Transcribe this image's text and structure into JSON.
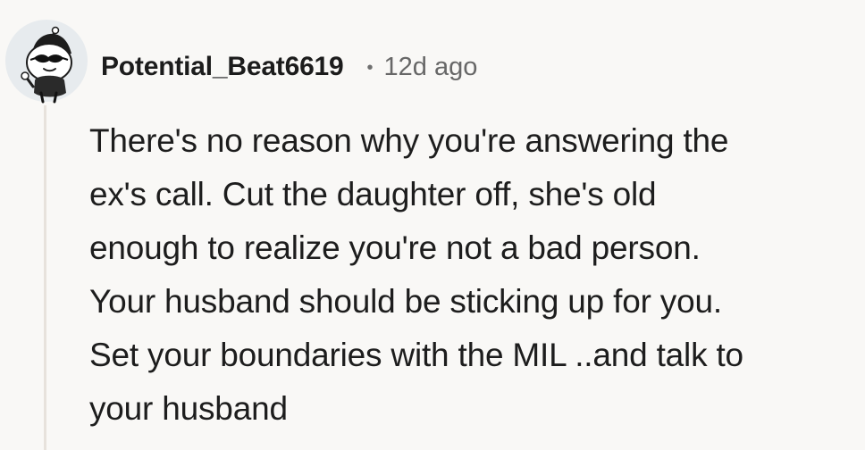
{
  "comment": {
    "username": "Potential_Beat6619",
    "separator": "•",
    "timestamp": "12d ago",
    "text": "There's no reason why you're answering the\nex's call. Cut the daughter off, she's old\nenough to realize you're not a bad person.\nYour husband should be sticking up for you.\nSet your boundaries with the MIL ..and talk to\nyour husband"
  },
  "avatar": {
    "icon": "snoo-avatar-icon",
    "background": "#e7ebee"
  },
  "colors": {
    "page_background": "#f9f8f6",
    "thread_line": "#e7e2dc",
    "text": "#1c1c1c",
    "muted_text": "#676767"
  }
}
